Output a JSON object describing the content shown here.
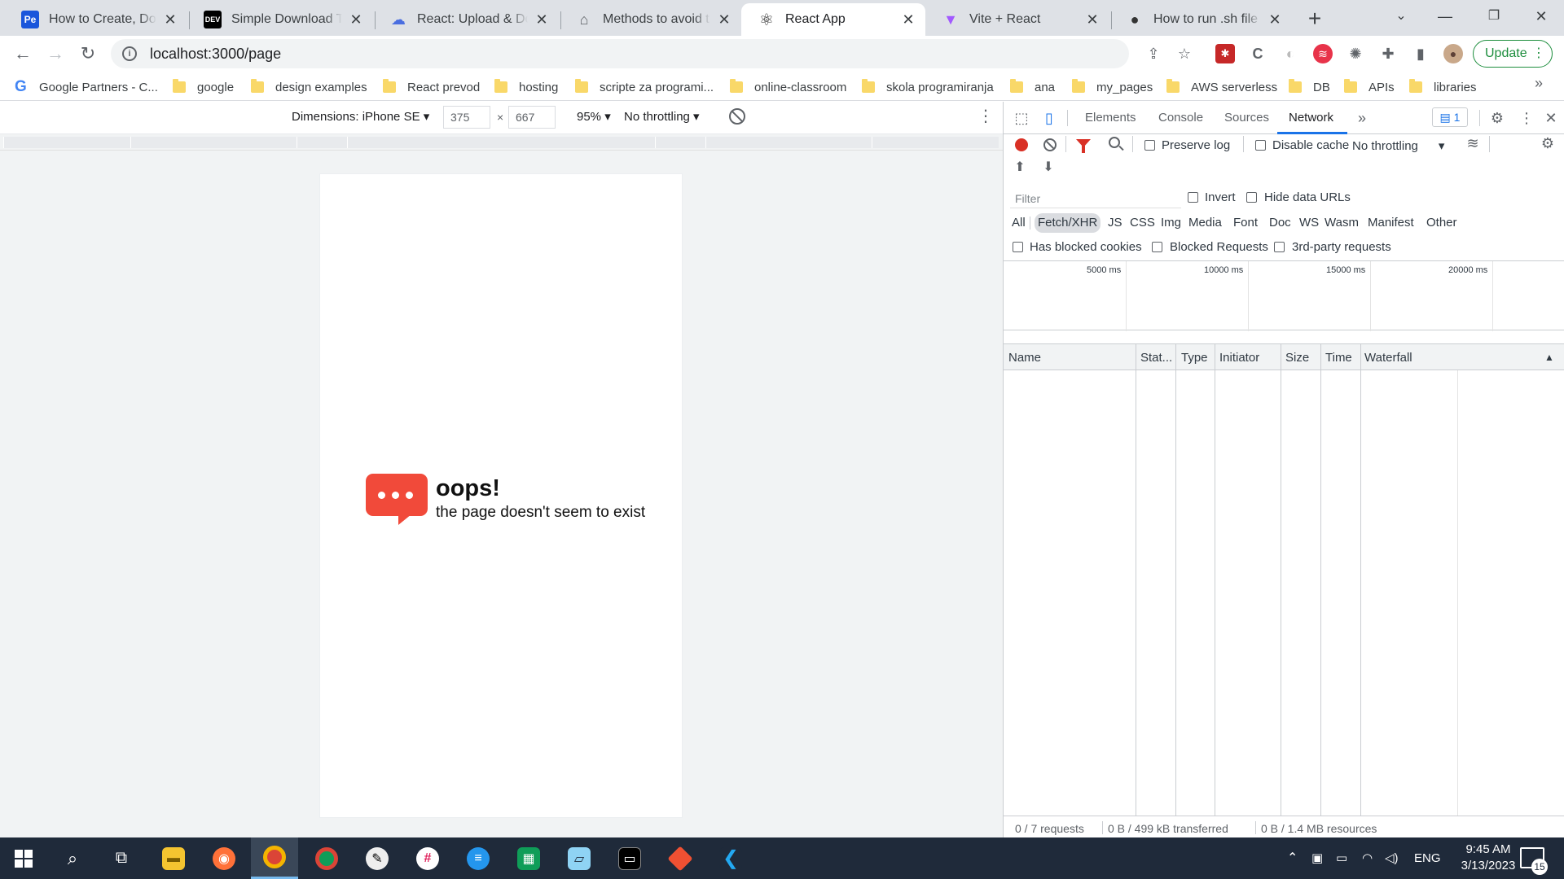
{
  "tabs": [
    {
      "title": "How to Create, Downl",
      "favicon": "Pe"
    },
    {
      "title": "Simple Download Tex",
      "favicon": "DEV"
    },
    {
      "title": "React: Upload & Dow",
      "favicon": "cloud-icon"
    },
    {
      "title": "Methods to avoid the",
      "favicon": "home-icon"
    },
    {
      "title": "React App",
      "favicon": "react-icon"
    },
    {
      "title": "Vite + React",
      "favicon": "vite-icon"
    },
    {
      "title": "How to run .sh file sh",
      "favicon": "user-icon"
    }
  ],
  "active_tab": 4,
  "address": {
    "url": "localhost:3000/page"
  },
  "update_label": "Update",
  "bookmarks": [
    "Google Partners - C...",
    "google",
    "design examples",
    "React prevod",
    "hosting",
    "scripte za programi...",
    "online-classroom",
    "skola programiranja",
    "ana",
    "my_pages",
    "AWS serverless",
    "DB",
    "APIs",
    "libraries"
  ],
  "device_toolbar": {
    "dimensions_label": "Dimensions: iPhone SE",
    "width": "375",
    "height": "667",
    "times": "×",
    "zoom": "95%",
    "throttling": "No throttling"
  },
  "page": {
    "title": "oops!",
    "subtitle": "the page doesn't seem to exist"
  },
  "devtools": {
    "tabs": [
      "Elements",
      "Console",
      "Sources",
      "Network"
    ],
    "active_tab": "Network",
    "issues_count": "1",
    "preserve_log": "Preserve log",
    "disable_cache": "Disable cache",
    "throttling": "No throttling",
    "filter_placeholder": "Filter",
    "invert": "Invert",
    "hide_data_urls": "Hide data URLs",
    "types": [
      "All",
      "Fetch/XHR",
      "JS",
      "CSS",
      "Img",
      "Media",
      "Font",
      "Doc",
      "WS",
      "Wasm",
      "Manifest",
      "Other"
    ],
    "active_type": "Fetch/XHR",
    "has_blocked_cookies": "Has blocked cookies",
    "blocked_requests": "Blocked Requests",
    "third_party": "3rd-party requests",
    "timeline_labels": [
      "5000 ms",
      "10000 ms",
      "15000 ms",
      "20000 ms"
    ],
    "columns": [
      "Name",
      "Stat...",
      "Type",
      "Initiator",
      "Size",
      "Time",
      "Waterfall"
    ],
    "status": {
      "requests": "0 / 7 requests",
      "transferred": "0 B / 499 kB transferred",
      "resources": "0 B / 1.4 MB resources"
    }
  },
  "taskbar": {
    "language": "ENG",
    "time": "9:45 AM",
    "date": "3/13/2023",
    "notifications": "15"
  },
  "colors": {
    "accent": "#1a73e8",
    "record": "#d93025",
    "bubble": "#f14a3a",
    "update": "#1e8e3e"
  }
}
